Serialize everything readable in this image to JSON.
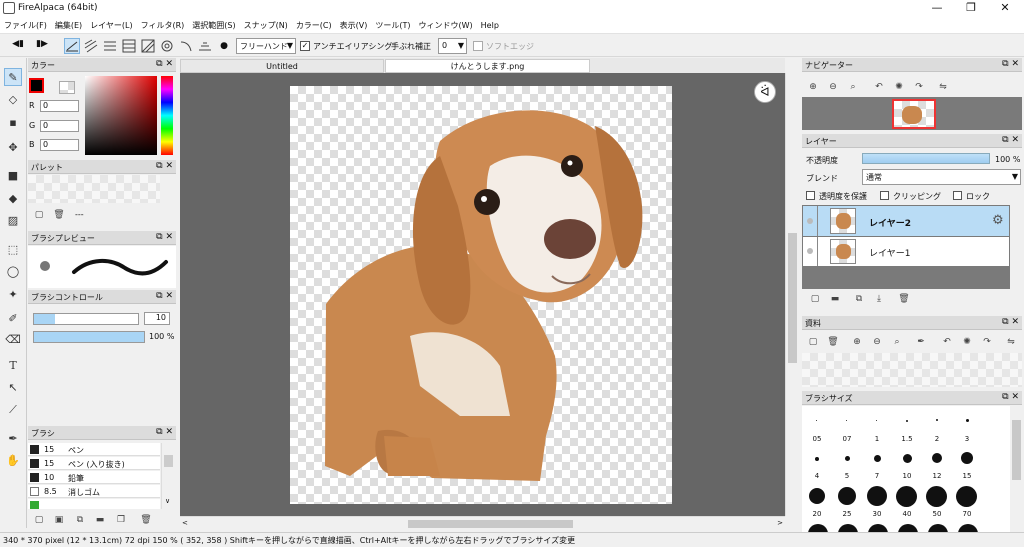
{
  "window": {
    "title": "FireAlpaca (64bit)",
    "minimize": "—",
    "restore": "❐",
    "close": "✕"
  },
  "menu": [
    "ファイル(F)",
    "編集(E)",
    "レイヤー(L)",
    "フィルタ(R)",
    "選択範囲(S)",
    "スナップ(N)",
    "カラー(C)",
    "表示(V)",
    "ツール(T)",
    "ウィンドウ(W)",
    "Help"
  ],
  "toolbar": {
    "mode": "フリーハンド",
    "antialias": "アンチエイリアシング",
    "correction_label": "手ぶれ補正",
    "correction_value": "0",
    "soft_edge": "ソフトエッジ"
  },
  "color_panel": {
    "title": "カラー",
    "r_label": "R",
    "g_label": "G",
    "b_label": "B",
    "r": "0",
    "g": "0",
    "b": "0"
  },
  "palette_panel": {
    "title": "パレット",
    "empty": "---"
  },
  "brush_preview": {
    "title": "ブラシプレビュー"
  },
  "brush_control": {
    "title": "ブラシコントロール",
    "size": "10",
    "opacity": "100 %",
    "size_fraction": 0.2,
    "opacity_fraction": 1.0
  },
  "brush_panel": {
    "title": "ブラシ",
    "items": [
      {
        "size": "15",
        "name": "ペン",
        "swatch": "#222222"
      },
      {
        "size": "15",
        "name": "ペン (入り抜き)",
        "swatch": "#222222"
      },
      {
        "size": "10",
        "name": "鉛筆",
        "swatch": "#222222"
      },
      {
        "size": "8.5",
        "name": "消しゴム",
        "swatch": "#ffffff"
      }
    ]
  },
  "tabs": [
    {
      "label": "Untitled"
    },
    {
      "label": "けんとうします.png"
    }
  ],
  "navigator": {
    "title": "ナビゲーター"
  },
  "layer_panel": {
    "title": "レイヤー",
    "opacity_label": "不透明度",
    "opacity_value": "100 %",
    "blend_label": "ブレンド",
    "blend_value": "通常",
    "protect_alpha": "透明度を保護",
    "clipping": "クリッピング",
    "lock": "ロック",
    "layers": [
      {
        "name": "レイヤー2",
        "selected": true
      },
      {
        "name": "レイヤー1",
        "selected": false
      }
    ]
  },
  "materials": {
    "title": "資料"
  },
  "brush_size": {
    "title": "ブラシサイズ",
    "row1": [
      "05",
      "07",
      "1",
      "1.5",
      "2",
      "3"
    ],
    "row2": [
      "4",
      "5",
      "7",
      "10",
      "12",
      "15"
    ],
    "row3": [
      "20",
      "25",
      "30",
      "40",
      "50",
      "70"
    ]
  },
  "status": "340 * 370 pixel  (12 * 13.1cm)  72 dpi  150 %  ( 352, 358 )  Shiftキーを押しながらで直線描画、Ctrl+Altキーを押しながら左右ドラッグでブラシサイズ変更",
  "colors": {
    "accent": "#cce4f7",
    "layer_selected": "#b9dcf5",
    "canvas_bg": "#666666",
    "dog_tan": "#c7844a"
  }
}
